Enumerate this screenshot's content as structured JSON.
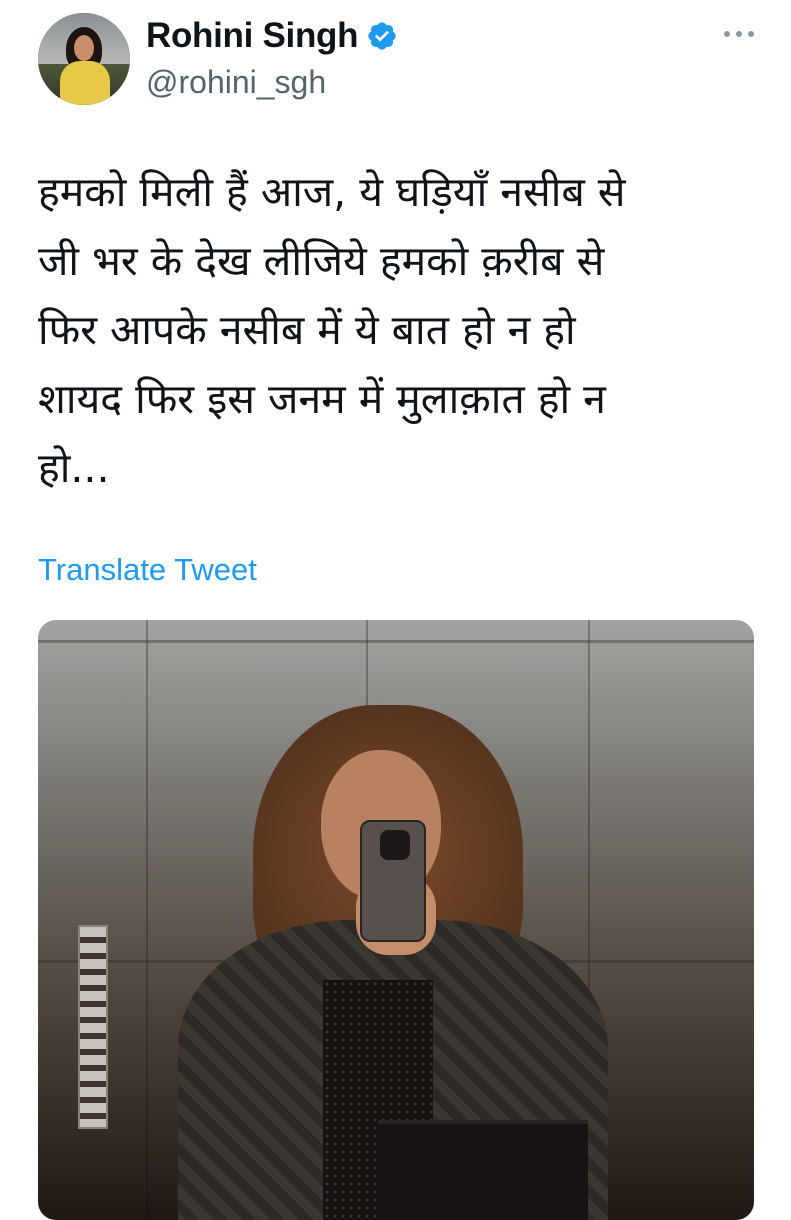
{
  "author": {
    "display_name": "Rohini Singh",
    "handle": "@rohini_sgh",
    "verified": true,
    "avatar_icon": "profile-photo"
  },
  "tweet": {
    "lines": [
      "हमको मिली हैं आज, ये घड़ियाँ नसीब से",
      "जी भर के देख लीजिये हमको क़रीब से",
      "फिर आपके नसीब में ये बात हो न हो",
      "शायद फिर इस जनम में मुलाक़ात हो न",
      "हो..."
    ],
    "translate_label": "Translate Tweet"
  },
  "media": {
    "type": "photo",
    "description_icon": "elevator-selfie-photo"
  },
  "colors": {
    "link": "#1d9bf0",
    "secondary_text": "#536471",
    "verified": "#1d9bf0",
    "primary_text": "#0f1419"
  },
  "icons": {
    "verified": "verified-badge-icon",
    "more": "more-options-icon"
  }
}
